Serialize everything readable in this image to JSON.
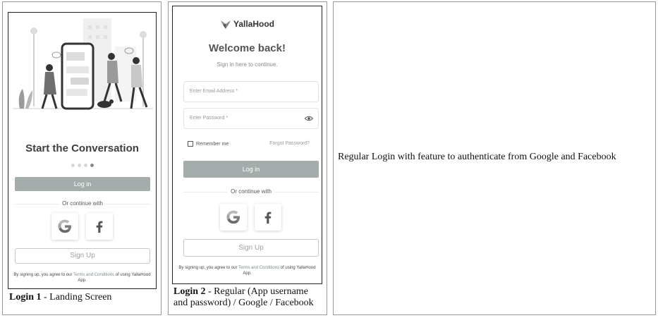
{
  "screen1": {
    "title": "Start the Conversation",
    "login_label": "Log in",
    "or_text": "Or continue with",
    "signup_label": "Sign Up",
    "terms_prefix": "By signing up, you agree to our ",
    "terms_link": "Terms and Conditions",
    "terms_suffix": " of using YallaHood App.",
    "caption_bold": "Login 1",
    "caption_rest": " - Landing Screen",
    "social": [
      "google-icon",
      "facebook-icon"
    ]
  },
  "screen2": {
    "brand": "YallaHood",
    "welcome": "Welcome back!",
    "subtitle": "Sign in here to continue.",
    "email_placeholder": "Enter Email Address *",
    "password_placeholder": "Enter Password *",
    "remember_label": "Remember me",
    "forgot_label": "Forgot Password?",
    "login_label": "Log in",
    "or_text": "Or continue with",
    "signup_label": "Sign Up",
    "terms_prefix": "By signing up, you agree to our ",
    "terms_link": "Terms and Conditions",
    "terms_suffix": " of using YallaHood App.",
    "caption_bold": "Login 2",
    "caption_rest": " - Regular (App username and password) / Google / Facebook"
  },
  "description": "Regular Login with feature to authenticate from Google and Facebook",
  "colors": {
    "button_gray": "#a5acac",
    "facebook_gray": "#555555",
    "google_gray": "#8a8a8a"
  }
}
